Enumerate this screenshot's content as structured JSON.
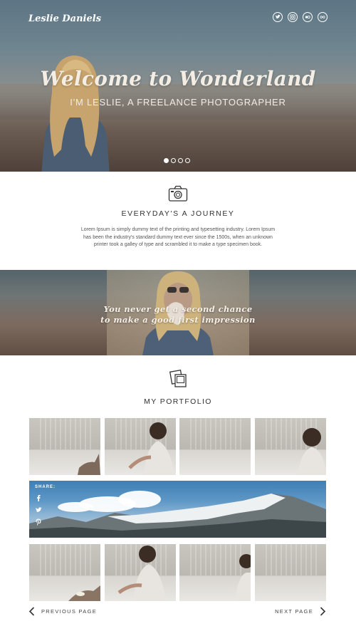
{
  "header": {
    "brand": "Leslie Daniels",
    "socials": [
      "twitter-icon",
      "instagram-icon",
      "flickr-icon",
      "infinity-icon"
    ]
  },
  "hero": {
    "title": "Welcome to Wonderland",
    "subtitle": "I'M LESLIE, A FREELANCE PHOTOGRAPHER",
    "slides": 4,
    "active_slide": 1
  },
  "intro": {
    "icon": "camera-icon",
    "title": "EVERYDAY'S A JOURNEY",
    "text": "Lorem Ipsum is simply dummy text of the printing and typesetting industry. Lorem Ipsum has been the industry's standard dummy text ever since the 1500s, when an unknown printer took a galley of type and scrambled it to make a type specimen book."
  },
  "quote": {
    "line1": "You never get a second chance",
    "line2": "to make a good first impression"
  },
  "portfolio": {
    "icon": "photos-icon",
    "title": "MY PORTFOLIO",
    "share_label": "SHARE:",
    "share_icons": [
      "facebook-icon",
      "twitter-icon",
      "pinterest-icon"
    ]
  },
  "pagination": {
    "previous": "PREVIOUS PAGE",
    "next": "NEXT PAGE"
  },
  "colors": {
    "text": "#333333",
    "white": "#ffffff"
  }
}
